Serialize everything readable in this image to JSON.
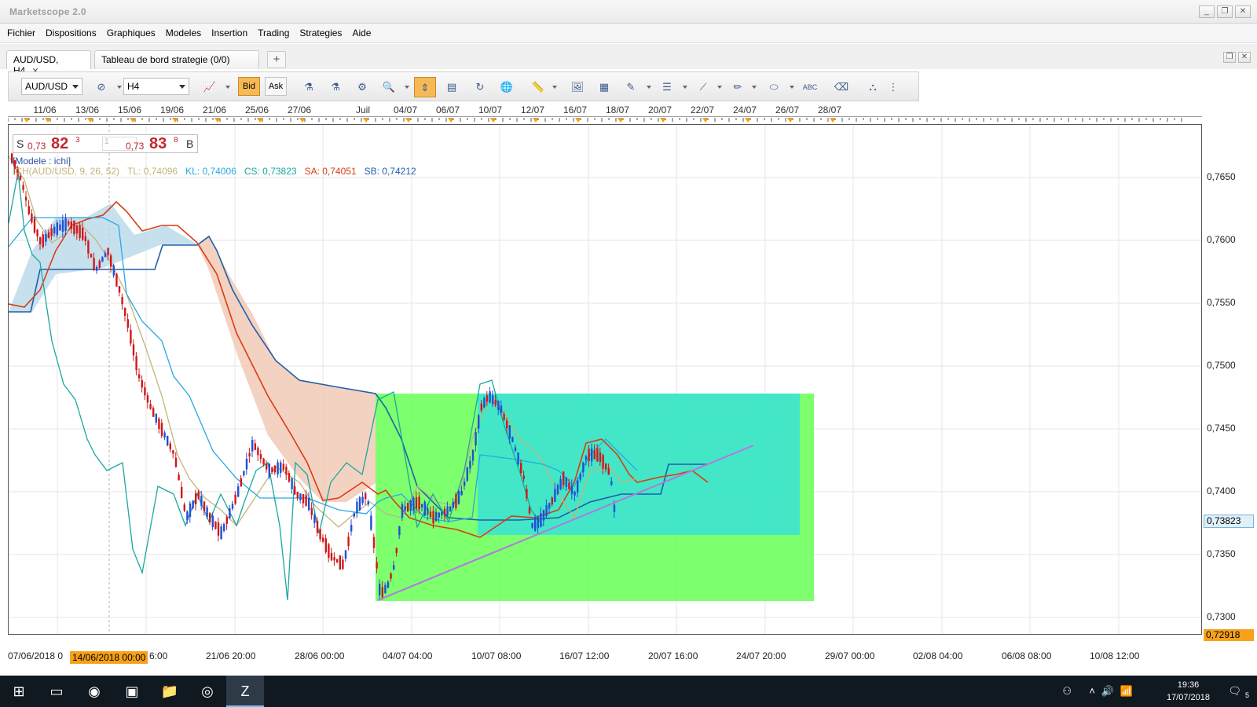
{
  "window": {
    "title": "Marketscope 2.0"
  },
  "menu": [
    "Fichier",
    "Dispositions",
    "Graphiques",
    "Modeles",
    "Insertion",
    "Trading",
    "Strategies",
    "Aide"
  ],
  "tabs": [
    {
      "label": "AUD/USD, H4",
      "active": true
    },
    {
      "label": "Tableau de bord strategie (0/0)",
      "active": false
    }
  ],
  "toolbar": {
    "symbol": "AUD/USD",
    "timeframe": "H4",
    "bid_label": "Bid",
    "ask_label": "Ask"
  },
  "top_dates": [
    "11/06",
    "13/06",
    "15/06",
    "19/06",
    "21/06",
    "25/06",
    "27/06",
    "Juil",
    "04/07",
    "06/07",
    "10/07",
    "12/07",
    "16/07",
    "18/07",
    "20/07",
    "22/07",
    "24/07",
    "26/07",
    "28/07"
  ],
  "quote": {
    "side_sell": "S",
    "sell_prefix": "0,73",
    "sell_big": "82",
    "sell_sup": "3",
    "amount": "1",
    "buy_prefix": "0,73",
    "buy_big": "83",
    "buy_sup": "8",
    "side_buy": "B"
  },
  "model_label": "[Modele : ichi]",
  "ichimoku_legend": {
    "name": "ICH(AUD/USD, 9, 26, 52)",
    "tl": "TL: 0,74096",
    "kl": "KL: 0,74006",
    "cs": "CS: 0,73823",
    "sa": "SA: 0,74051",
    "sb": "SB: 0,74212"
  },
  "price_axis": [
    "0,7650",
    "0,7600",
    "0,7550",
    "0,7500",
    "0,7450",
    "0,7400",
    "0,7350",
    "0,7300"
  ],
  "current_price": "0,73823",
  "low_price": "0,72918",
  "bottom_dates": [
    "07/06/2018 0",
    "6:00",
    "21/06 20:00",
    "28/06 00:00",
    "04/07 04:00",
    "10/07 08:00",
    "16/07 12:00",
    "20/07 16:00",
    "24/07 20:00",
    "29/07 00:00",
    "02/08 04:00",
    "06/08 08:00",
    "10/08 12:00"
  ],
  "cursor_date": "14/06/2018 00:00",
  "colors": {
    "up_candle": "#1f4fd6",
    "down_candle": "#d01818",
    "tenkan": "#c4b47a",
    "kijun": "#2aa8e0",
    "chikou": "#1aa7a0",
    "senkou_a": "#d83c12",
    "senkou_b": "#1f5fa8",
    "cloud_bull": "#b8d8ea",
    "cloud_bear": "#f1c7b3",
    "green_zone": "#66ff55",
    "cyan_zone": "#38e3d7",
    "trendline": "#b07adf"
  },
  "taskbar": {
    "time": "19:36",
    "date": "17/07/2018",
    "notifications": "5"
  }
}
